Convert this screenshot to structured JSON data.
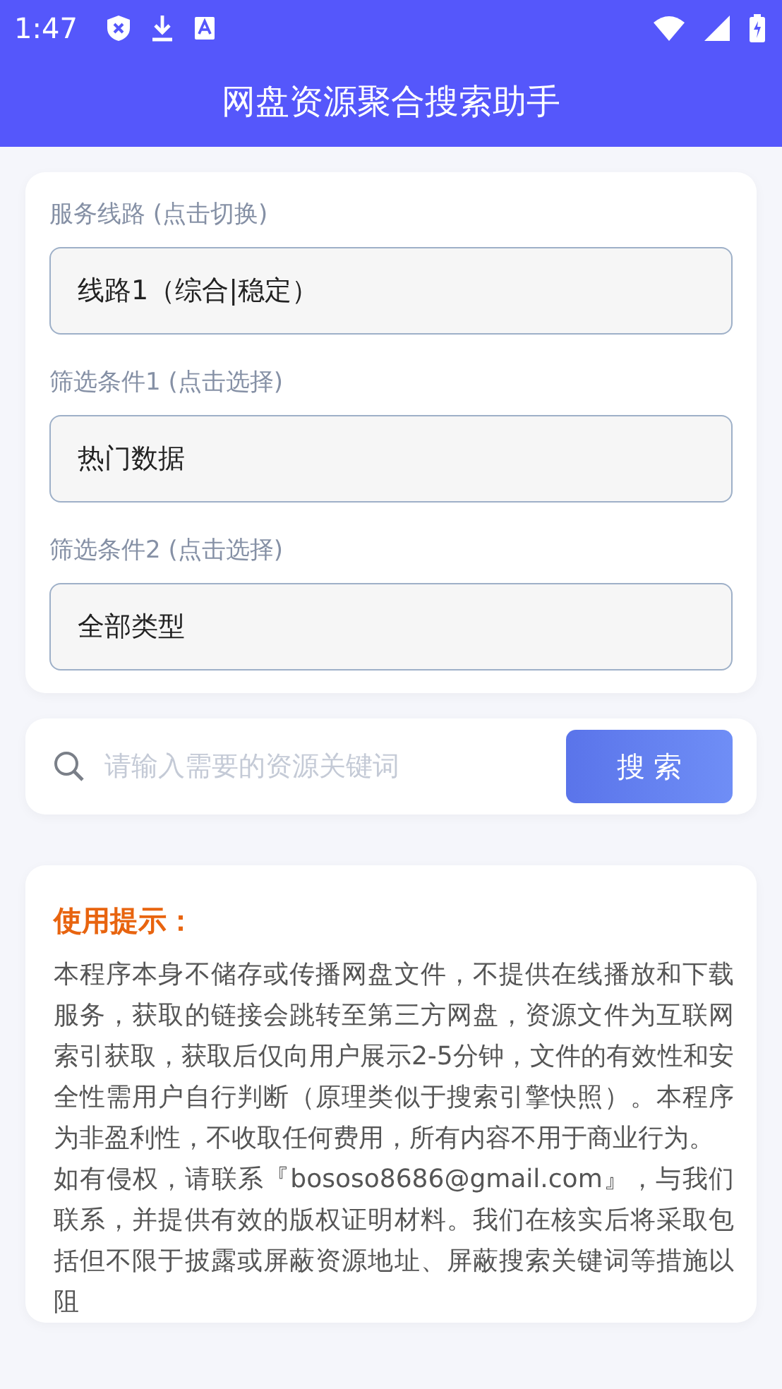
{
  "status_bar": {
    "time": "1:47"
  },
  "app_bar": {
    "title": "网盘资源聚合搜索助手"
  },
  "filters": [
    {
      "label": "服务线路 (点击切换)",
      "value": "线路1（综合|稳定）"
    },
    {
      "label": "筛选条件1 (点击选择)",
      "value": "热门数据"
    },
    {
      "label": "筛选条件2 (点击选择)",
      "value": "全部类型"
    }
  ],
  "search": {
    "placeholder": "请输入需要的资源关键词",
    "button": "搜 索"
  },
  "tips": {
    "title": "使用提示：",
    "paragraphs": [
      "本程序本身不储存或传播网盘文件，不提供在线播放和下载服务，获取的链接会跳转至第三方网盘，资源文件为互联网索引获取，获取后仅向用户展示2-5分钟，文件的有效性和安全性需用户自行判断（原理类似于搜索引擎快照）。本程序为非盈利性，不收取任何费用，所有内容不用于商业行为。",
      "如有侵权，请联系『bososo8686@gmail.com』，与我们联系，并提供有效的版权证明材料。我们在核实后将采取包括但不限于披露或屏蔽资源地址、屏蔽搜索关键词等措施以阻"
    ]
  }
}
